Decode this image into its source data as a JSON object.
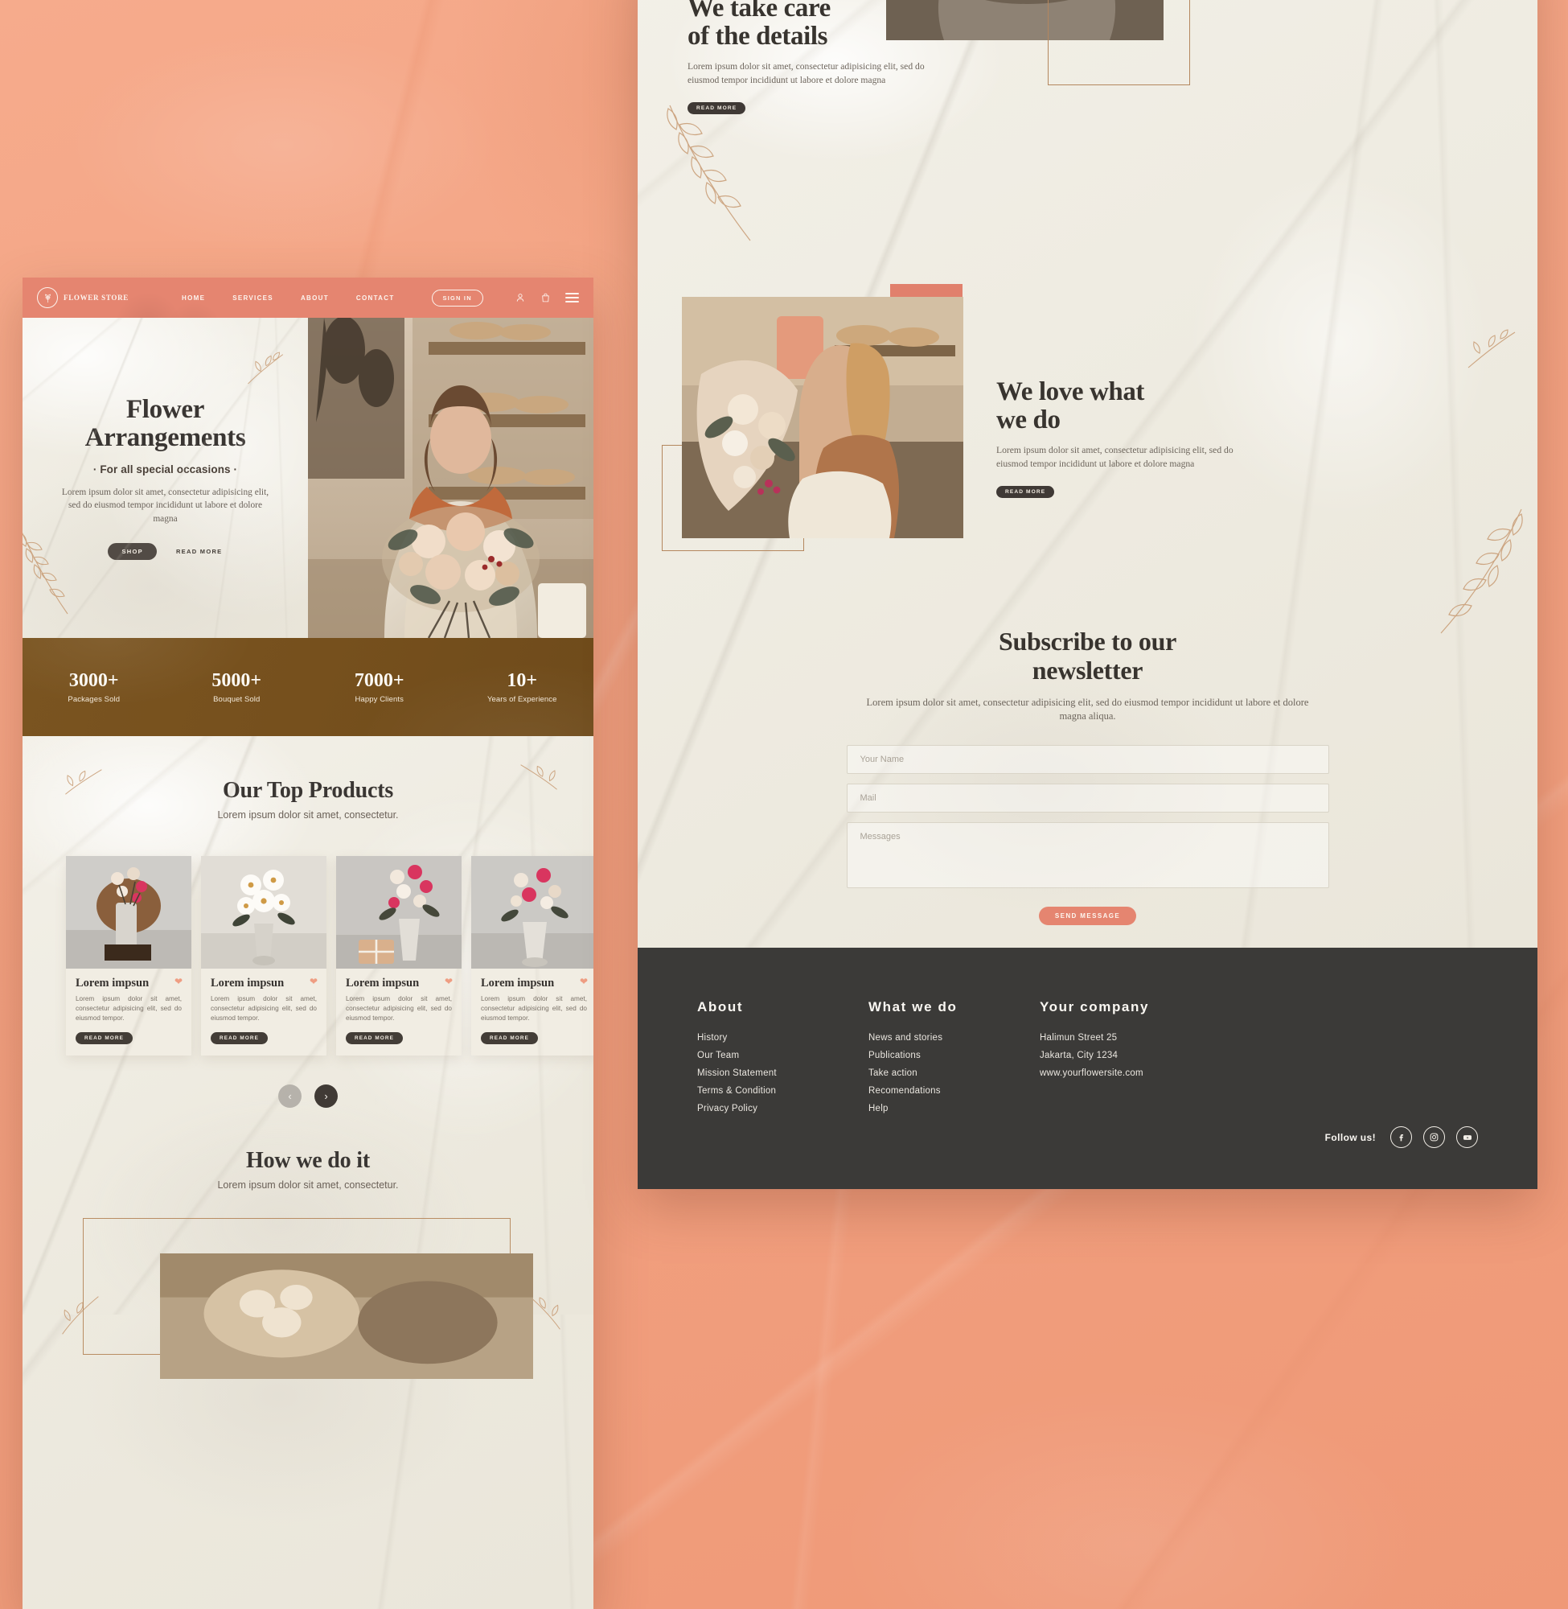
{
  "theme": {
    "coral": "#f2a181",
    "coral_accent": "#e58570",
    "brown_bar": "#79531f",
    "dark": "#3b3a38",
    "cream": "#f1ede3",
    "heading": "#3a3633"
  },
  "left_page": {
    "nav": {
      "brand": "FLOWER STORE",
      "brand_icon": "flower-emblem-icon",
      "links": [
        "HOME",
        "SERVICES",
        "ABOUT",
        "CONTACT"
      ],
      "signin_label": "SIGN IN",
      "icons": [
        "user-icon",
        "bag-icon",
        "hamburger-menu-icon"
      ]
    },
    "hero": {
      "title_line1": "Flower",
      "title_line2": "Arrangements",
      "subtitle": "· For all special occasions ·",
      "body": "Lorem ipsum dolor sit amet, consectetur adipisicing elit, sed do eiusmod tempor incididunt ut labore et dolore magna",
      "primary_button": "SHOP",
      "secondary_link": "READ MORE",
      "photo_alt": "florist-holding-bouquet-photo"
    },
    "stats": [
      {
        "value": "3000+",
        "label": "Packages Sold"
      },
      {
        "value": "5000+",
        "label": "Bouquet Sold"
      },
      {
        "value": "7000+",
        "label": "Happy Clients"
      },
      {
        "value": "10+",
        "label": "Years of Experience"
      }
    ],
    "products": {
      "title": "Our Top Products",
      "subtitle": "Lorem ipsum dolor sit amet, consectetur.",
      "cards": [
        {
          "title": "Lorem impsun",
          "text": "Lorem ipsum dolor sit amet, consectetur adipisicing elit, sed do eiusmod tempor.",
          "button": "READ MORE",
          "fav_icon": "heart-icon",
          "image_alt": "dried-flowers-in-stone-vase"
        },
        {
          "title": "Lorem impsun",
          "text": "Lorem ipsum dolor sit amet, consectetur adipisicing elit, sed do eiusmod tempor.",
          "button": "READ MORE",
          "fav_icon": "heart-icon",
          "image_alt": "white-daisies-in-vase"
        },
        {
          "title": "Lorem impsun",
          "text": "Lorem ipsum dolor sit amet, consectetur adipisicing elit, sed do eiusmod tempor.",
          "button": "READ MORE",
          "fav_icon": "heart-icon",
          "image_alt": "pink-roses-with-gift-box"
        },
        {
          "title": "Lorem impsun",
          "text": "Lorem ipsum dolor sit amet, consectetur adipisicing elit, sed do eiusmod tempor.",
          "button": "READ MORE",
          "fav_icon": "heart-icon",
          "image_alt": "pink-and-white-bouquet-in-vase"
        }
      ],
      "carousel": {
        "prev_icon": "chevron-left-icon",
        "next_icon": "chevron-right-icon"
      }
    },
    "how": {
      "title": "How we do it",
      "subtitle": "Lorem ipsum dolor sit amet, consectetur."
    }
  },
  "right_page": {
    "details": {
      "title_line1": "We take care",
      "title_line2": "of the details",
      "body": "Lorem ipsum dolor sit amet, consectetur adipisicing elit, sed do eiusmod tempor incididunt ut labore et dolore magna",
      "button": "READ MORE",
      "photo_alt": "hands-holding-white-roses-in-bucket"
    },
    "love": {
      "title_line1": "We love what",
      "title_line2": "we do",
      "body": "Lorem ipsum dolor sit amet, consectetur adipisicing elit, sed do eiusmod tempor incididunt ut labore et dolore magna",
      "button": "READ MORE",
      "photo_alt": "florist-arranging-wrapped-bouquet"
    },
    "newsletter": {
      "title_line1": "Subscribe to our",
      "title_line2": "newsletter",
      "body": "Lorem ipsum dolor sit amet, consectetur adipisicing elit, sed do eiusmod tempor incididunt ut labore et dolore magna aliqua.",
      "name_placeholder": "Your Name",
      "name_value": "",
      "mail_placeholder": "Mail",
      "mail_value": "",
      "message_placeholder": "Messages",
      "message_value": "",
      "submit_label": "SEND MESSAGE"
    },
    "footer": {
      "columns": [
        {
          "heading": "About",
          "links": [
            "History",
            "Our Team",
            "Mission Statement",
            "Terms & Condition",
            "Privacy Policy"
          ]
        },
        {
          "heading": "What we do",
          "links": [
            "News and stories",
            "Publications",
            "Take action",
            "Recomendations",
            "Help"
          ]
        },
        {
          "heading": "Your company",
          "links": [
            "Halimun Street 25",
            "Jakarta, City 1234",
            "www.yourflowersite.com"
          ]
        }
      ],
      "follow_label": "Follow us!",
      "socials": [
        "facebook-icon",
        "instagram-icon",
        "youtube-icon"
      ]
    }
  }
}
